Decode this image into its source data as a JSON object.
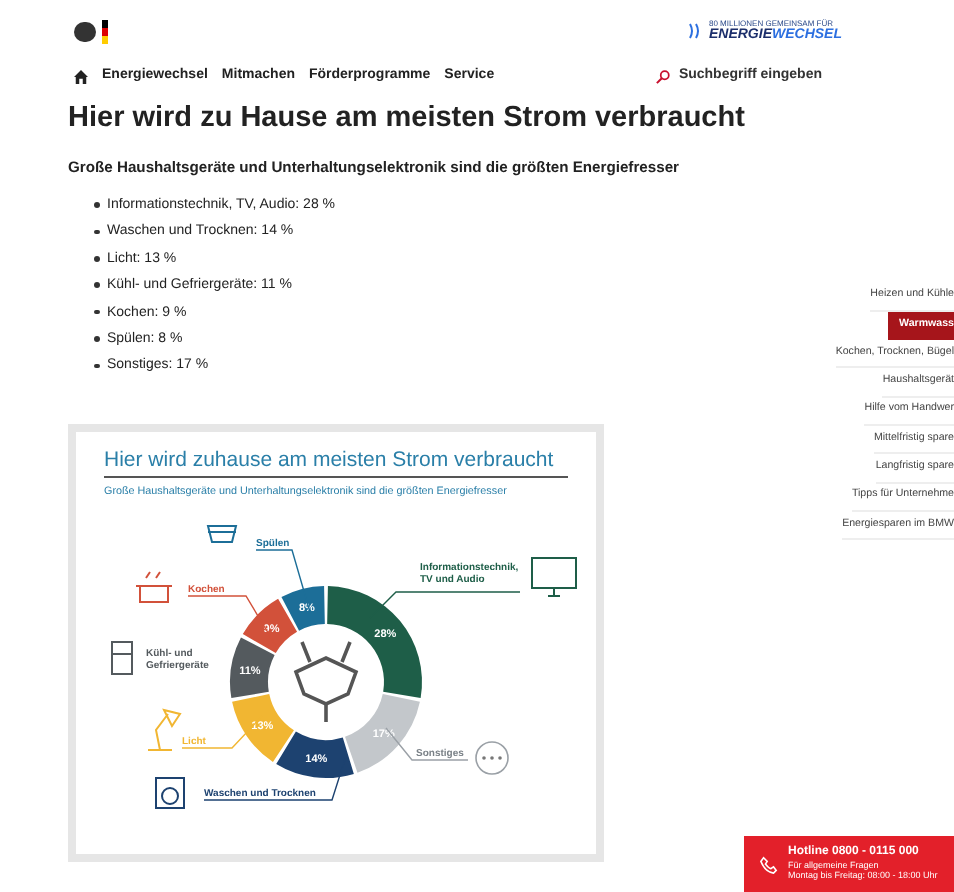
{
  "logo": {
    "tagline": "80 MILLIONEN GEMEINSAM FÜR",
    "word_1": "ENERGIE",
    "word_2": "WECHSEL"
  },
  "nav": {
    "items": [
      "Energiewechsel",
      "Mitmachen",
      "Förderprogramme",
      "Service"
    ],
    "search": {
      "placeholder": "Suchbegriff eingeben"
    }
  },
  "title": "Hier wird zu Hause am meisten Strom verbraucht",
  "subtitle": "Große Haushaltsgeräte und Unterhaltungselektronik sind die größten Energiefresser",
  "list": [
    "Informationstechnik, TV, Audio: 28 %",
    "Waschen und Trocknen: 14 %",
    "Licht: 13 %",
    "Kühl- und Gefriergeräte: 11 %",
    "Kochen: 9 %",
    "Spülen: 8 %",
    "Sonstiges: 17 %"
  ],
  "sidebar": {
    "items": [
      {
        "label": "Heizen und Kühle",
        "selected": false
      },
      {
        "label": "Warmwass",
        "selected": true
      },
      {
        "label": "Kochen, Trocknen, Bügel",
        "selected": false
      },
      {
        "label": "Haushaltsgerät",
        "selected": false
      },
      {
        "label": "Hilfe vom Handwer",
        "selected": false
      },
      {
        "label": "Mittelfristig spare",
        "selected": false
      },
      {
        "label": "Langfristig spare",
        "selected": false
      },
      {
        "label": "Tipps für Unternehme",
        "selected": false
      },
      {
        "label": "Energiesparen im BMW",
        "selected": false
      }
    ]
  },
  "infographic": {
    "title": "Hier wird zuhause am meisten Strom verbraucht",
    "subtitle": "Große Haushaltsgeräte und Unterhaltungselektronik sind die größten Energiefresser",
    "chart_data": {
      "type": "donut",
      "categories": [
        "Informationstechnik, TV und Audio",
        "Sonstiges",
        "Waschen und Trocknen",
        "Licht",
        "Kühl- und Gefriergeräte",
        "Kochen",
        "Spülen"
      ],
      "series": [
        {
          "values": [
            28,
            17,
            14,
            13,
            11,
            9,
            8
          ]
        }
      ],
      "colors": [
        "#1e5e48",
        "#c3c7cb",
        "#1d4270",
        "#f1b632",
        "#545a5e",
        "#d2513a",
        "#1c6e98"
      ],
      "value_labels": [
        "28%",
        "17%",
        "14%",
        "13%",
        "11%",
        "9%",
        "8%"
      ]
    }
  },
  "hotline": {
    "title": "Hotline 0800 - 0115 000",
    "line_1": "Für allgemeine Fragen",
    "line_2": "Montag bis Freitag: 08:00 - 18:00 Uhr"
  }
}
